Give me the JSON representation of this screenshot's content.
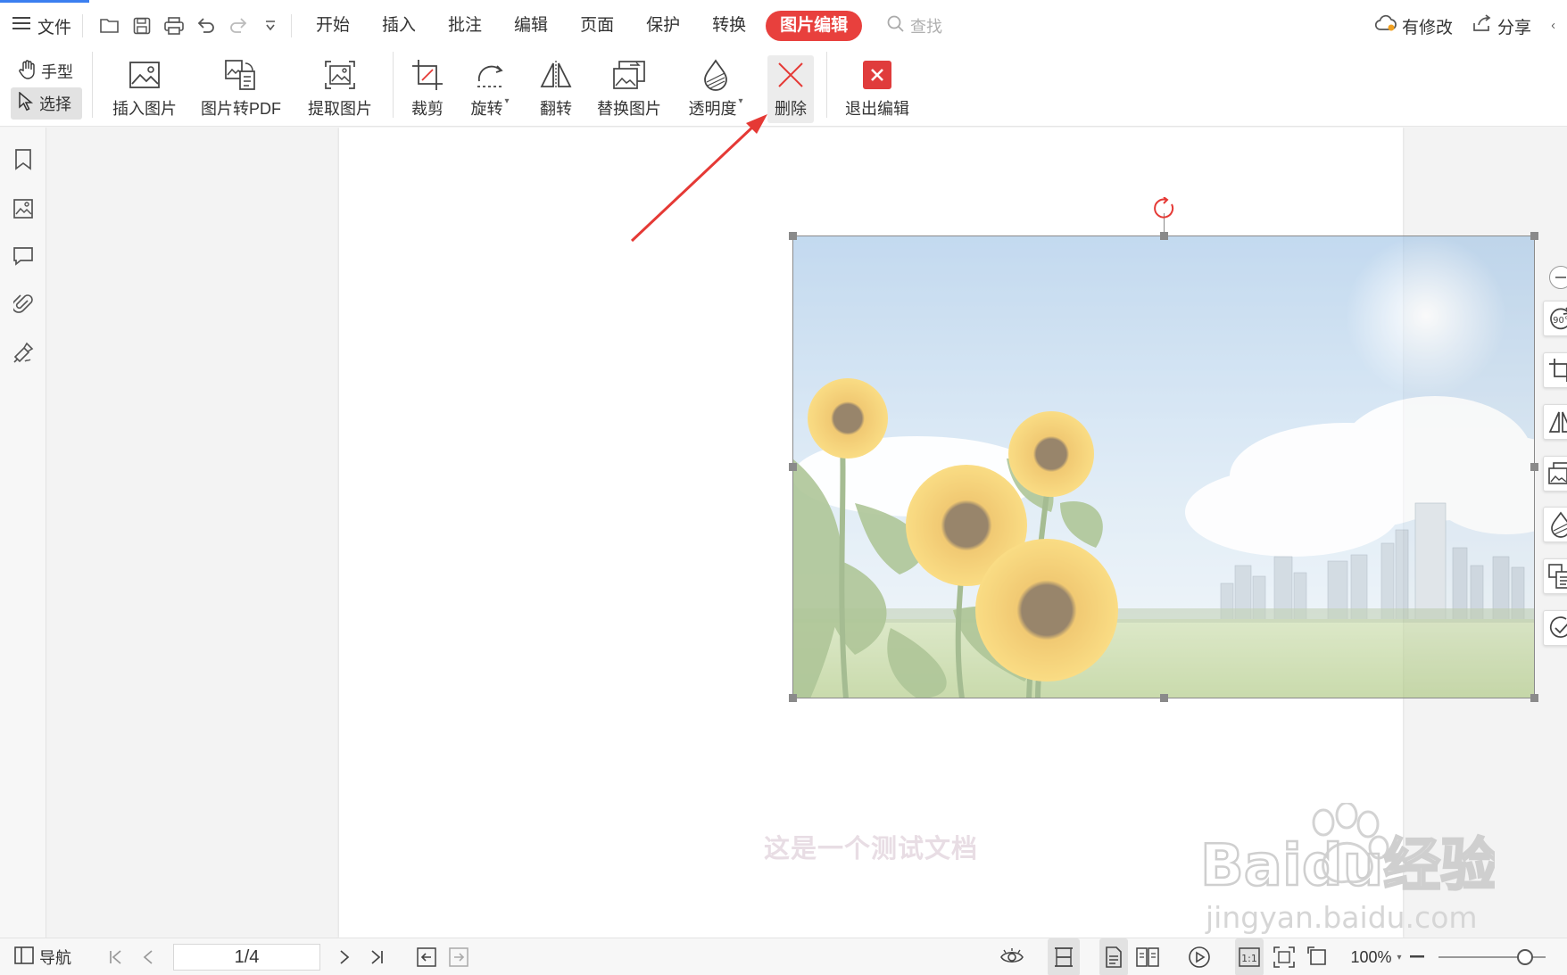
{
  "menubar": {
    "file_label": "文件",
    "tabs": [
      "开始",
      "插入",
      "批注",
      "编辑",
      "页面",
      "保护",
      "转换",
      "图片编辑"
    ],
    "active_tab": "图片编辑",
    "search_placeholder": "查找",
    "modified_label": "有修改",
    "share_label": "分享"
  },
  "ribbon": {
    "hand_label": "手型",
    "select_label": "选择",
    "buttons": [
      "插入图片",
      "图片转PDF",
      "提取图片",
      "裁剪",
      "旋转",
      "翻转",
      "替换图片",
      "透明度",
      "删除",
      "退出编辑"
    ]
  },
  "float_panel": {
    "rotate_label": "90°"
  },
  "document": {
    "body_text": "这是一个测试文档"
  },
  "watermark": {
    "brand": "Baidu经验",
    "url": "jingyan.baidu.com"
  },
  "statusbar": {
    "nav_label": "导航",
    "page_indicator": "1/4",
    "zoom": "100%"
  },
  "colors": {
    "accent": "#e8403d",
    "arrow": "#e53935",
    "exit_button": "#e03c3c"
  }
}
